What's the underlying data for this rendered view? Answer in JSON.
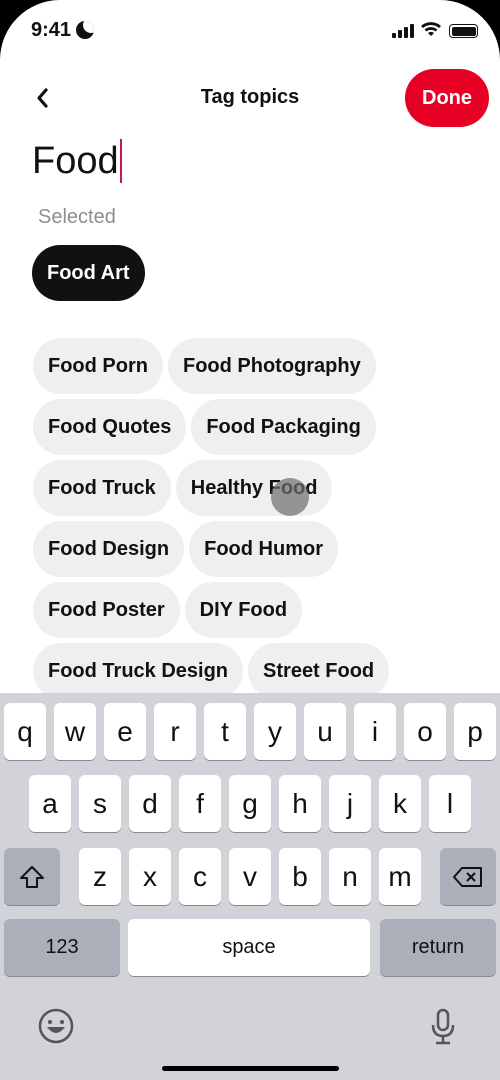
{
  "status_bar": {
    "time": "9:41"
  },
  "header": {
    "title": "Tag topics",
    "done_label": "Done"
  },
  "search": {
    "value": "Food"
  },
  "selected": {
    "label": "Selected",
    "chips": [
      "Food Art"
    ]
  },
  "suggestions": {
    "rows": [
      [
        "Food Porn",
        "Food Photography"
      ],
      [
        "Food Quotes",
        "Food Packaging"
      ],
      [
        "Food Truck",
        "Healthy Food"
      ],
      [
        "Food Design",
        "Food Humor"
      ],
      [
        "Food Poster",
        "DIY Food"
      ],
      [
        "Food Truck Design",
        "Street Food"
      ]
    ]
  },
  "keyboard": {
    "row1": [
      "q",
      "w",
      "e",
      "r",
      "t",
      "y",
      "u",
      "i",
      "o",
      "p"
    ],
    "row2": [
      "a",
      "s",
      "d",
      "f",
      "g",
      "h",
      "j",
      "k",
      "l"
    ],
    "row3": [
      "z",
      "x",
      "c",
      "v",
      "b",
      "n",
      "m"
    ],
    "numbers_label": "123",
    "space_label": "space",
    "return_label": "return"
  },
  "colors": {
    "accent": "#e60023",
    "chip_bg": "#efefef",
    "selected_chip_bg": "#111111",
    "keyboard_bg": "#d1d3d9"
  }
}
